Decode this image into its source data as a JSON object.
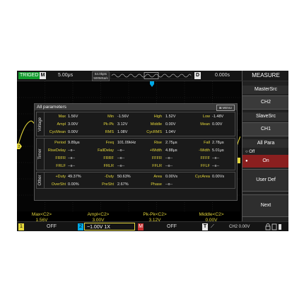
{
  "top": {
    "trig_status": "TRIGED",
    "mode": "M",
    "timebase": "5.00μs",
    "mem_line1": "64.0kpts",
    "mem_line2": "500MSa/s",
    "delay_label": "D",
    "delay": "0.000s",
    "menu_title": "MEASURE"
  },
  "panel": {
    "title": "All parameters",
    "menu_button": "MENU",
    "groups": [
      {
        "label": "Voltage",
        "rows": [
          [
            [
              "Max",
              "1.56V"
            ],
            [
              "Min",
              "-1.56V"
            ],
            [
              "High",
              "1.52V"
            ],
            [
              "Low",
              "-1.48V"
            ]
          ],
          [
            [
              "Ampl",
              "3.00V"
            ],
            [
              "Pk-Pk",
              "3.12V"
            ],
            [
              "Middle",
              "0.00V"
            ],
            [
              "Mean",
              "0.00V"
            ]
          ],
          [
            [
              "CycMean",
              "0.00V"
            ],
            [
              "RMS",
              "1.08V"
            ],
            [
              "CycRMS",
              "1.04V"
            ],
            [
              "",
              ""
            ]
          ]
        ]
      },
      {
        "label": "Timer",
        "rows": [
          [
            [
              "Period",
              "9.89μs"
            ],
            [
              "Freq",
              "101.09kHz"
            ],
            [
              "Rise",
              "2.75μs"
            ],
            [
              "Fall",
              "2.78μs"
            ]
          ],
          [
            [
              "RiseDelay",
              "--x--"
            ],
            [
              "FallDelay",
              "--x--"
            ],
            [
              "+Width",
              "4.88μs"
            ],
            [
              "-Width",
              "5.01μs"
            ]
          ],
          [
            [
              "FRFR",
              "--x--"
            ],
            [
              "FRRF",
              "--x--"
            ],
            [
              "FFFR",
              "--x--"
            ],
            [
              "FFFF",
              "--x--"
            ]
          ],
          [
            [
              "FRLF",
              "--x--"
            ],
            [
              "FRLR",
              "--x--"
            ],
            [
              "FFLR",
              "--x--"
            ],
            [
              "FFLF",
              "--x--"
            ]
          ]
        ]
      },
      {
        "label": "Other",
        "rows": [
          [
            [
              "+Duty",
              "49.37%"
            ],
            [
              "-Duty",
              "50.63%"
            ],
            [
              "Area",
              "0.00Vs"
            ],
            [
              "CycArea",
              "0.00Vs"
            ]
          ],
          [
            [
              "OverSht",
              "0.00%"
            ],
            [
              "PreSht",
              "2.67%"
            ],
            [
              "Phase",
              "--x--"
            ],
            [
              "",
              ""
            ]
          ]
        ]
      }
    ]
  },
  "measurements": [
    {
      "name": "Max<C2>",
      "value": "1.56V"
    },
    {
      "name": "Ampl<C2>",
      "value": "3.00V"
    },
    {
      "name": "Pk-Pk<C2>",
      "value": "3.12V"
    },
    {
      "name": "Middle<C2>",
      "value": "0.00V"
    }
  ],
  "bottom": {
    "ch1": "1",
    "ch1_state": "OFF",
    "ch2": "2",
    "ch2_setting": "~1.00V 1X",
    "math": "M",
    "math_state": "OFF",
    "trig": "T",
    "trig_slope": "⟋",
    "trig_level": "CH2 0.00V"
  },
  "menu": {
    "master_label": "MasterSrc",
    "master_value": "CH2",
    "slave_label": "SlaveSrc",
    "slave_value": "CH1",
    "all_para_label": "All Para",
    "all_para_off": "Off",
    "all_para_on": "On",
    "user_def": "User Def",
    "next": "Next"
  },
  "colors": {
    "ch2_trace": "#e2d53a",
    "label": "#e2d53a",
    "trig_green": "#129b2d",
    "on_red": "#8a1f1f"
  }
}
